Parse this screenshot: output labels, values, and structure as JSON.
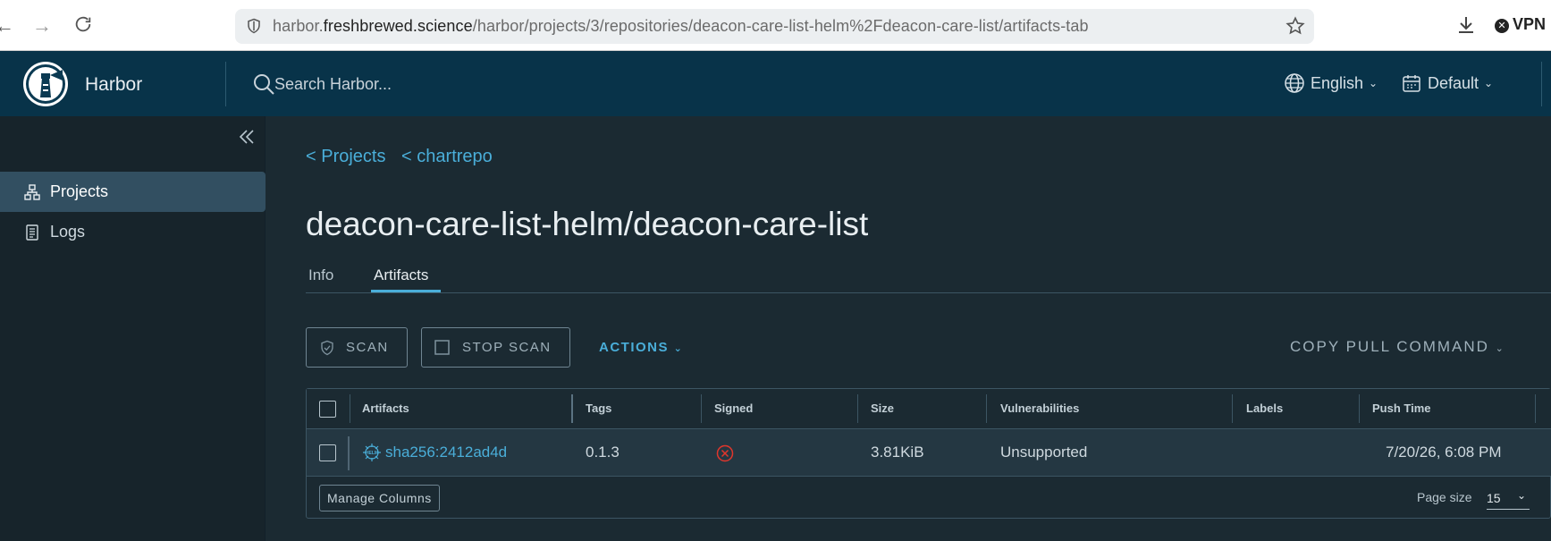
{
  "browser": {
    "url_prefix": "harbor.",
    "url_domain": "freshbrewed.science",
    "url_path": "/harbor/projects/3/repositories/deacon-care-list-helm%2Fdeacon-care-list/artifacts-tab",
    "vpn_label": "VPN"
  },
  "header": {
    "brand": "Harbor",
    "search_placeholder": "Search Harbor...",
    "language": "English",
    "theme": "Default"
  },
  "sidebar": {
    "items": [
      {
        "label": "Projects",
        "icon": "projects-icon",
        "active": true
      },
      {
        "label": "Logs",
        "icon": "logs-icon",
        "active": false
      }
    ]
  },
  "breadcrumbs": [
    "< Projects",
    "< chartrepo"
  ],
  "page_title": "deacon-care-list-helm/deacon-care-list",
  "tabs": [
    {
      "label": "Info",
      "active": false
    },
    {
      "label": "Artifacts",
      "active": true
    }
  ],
  "toolbar": {
    "scan": "SCAN",
    "stop_scan": "STOP SCAN",
    "actions": "ACTIONS",
    "copy_pull": "COPY PULL COMMAND"
  },
  "table": {
    "columns": [
      "Artifacts",
      "Tags",
      "Signed",
      "Size",
      "Vulnerabilities",
      "Labels",
      "Push Time"
    ],
    "rows": [
      {
        "artifact": "sha256:2412ad4d",
        "artifact_type_badge": "HELM",
        "tags": "0.1.3",
        "signed": "not-signed-icon",
        "size": "3.81KiB",
        "vulnerabilities": "Unsupported",
        "labels": "",
        "push_time": "7/20/26, 6:08 PM"
      }
    ],
    "manage_columns": "Manage Columns",
    "page_size_label": "Page size",
    "page_size": "15"
  },
  "colors": {
    "accent": "#4aaed9",
    "header_bg": "#083349",
    "sidebar_bg": "#17242b",
    "main_bg": "#1b2a32",
    "error_red": "#e0362c"
  }
}
